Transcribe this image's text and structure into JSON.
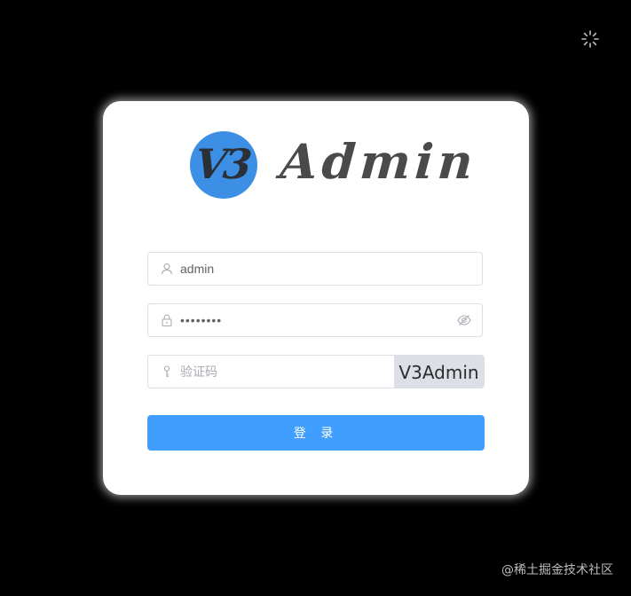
{
  "theme_toggle": {
    "icon": "sun-icon"
  },
  "logo": {
    "badge_text": "V3",
    "text": "Admin"
  },
  "form": {
    "username": {
      "icon": "user-icon",
      "value": "admin",
      "placeholder": ""
    },
    "password": {
      "icon": "lock-icon",
      "value": "12345678",
      "toggle_icon": "eye-icon"
    },
    "code": {
      "icon": "key-icon",
      "value": "",
      "placeholder": "验证码"
    },
    "captcha_text": "V3Admin",
    "login_label": "登 录"
  },
  "watermark": "@稀土掘金技术社区",
  "colors": {
    "background": "#000000",
    "card": "#ffffff",
    "primary": "#409eff",
    "logo_blue": "#3d8fe6",
    "captcha_bg": "#dcdfe6"
  }
}
